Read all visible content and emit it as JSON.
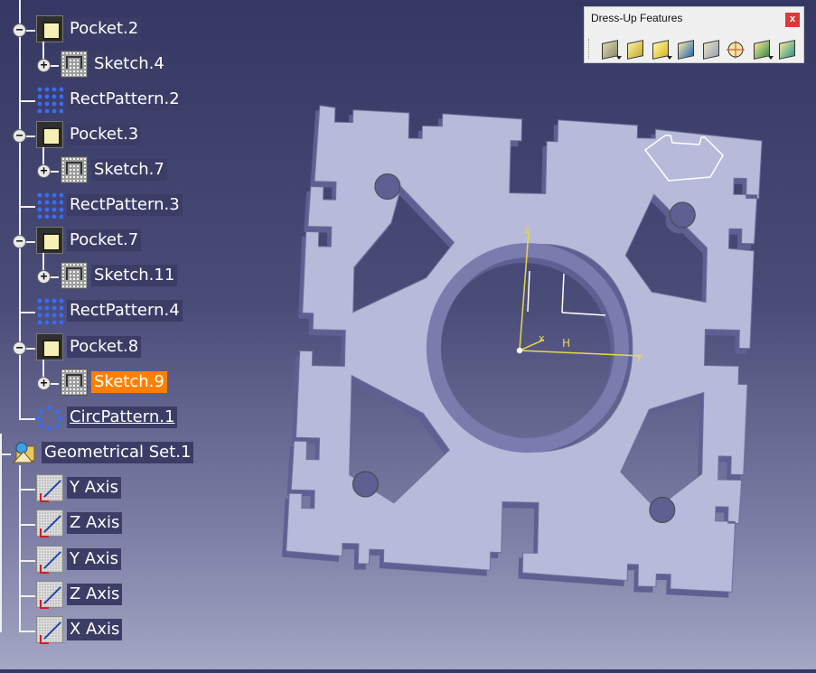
{
  "tree": {
    "items": [
      {
        "label": "Pocket.2",
        "icon": "pocket-icon"
      },
      {
        "label": "Sketch.4",
        "icon": "sketch-icon"
      },
      {
        "label": "RectPattern.2",
        "icon": "rect-pattern-icon"
      },
      {
        "label": "Pocket.3",
        "icon": "pocket-icon"
      },
      {
        "label": "Sketch.7",
        "icon": "sketch-icon"
      },
      {
        "label": "RectPattern.3",
        "icon": "rect-pattern-icon"
      },
      {
        "label": "Pocket.7",
        "icon": "pocket-icon"
      },
      {
        "label": "Sketch.11",
        "icon": "sketch-icon"
      },
      {
        "label": "RectPattern.4",
        "icon": "rect-pattern-icon"
      },
      {
        "label": "Pocket.8",
        "icon": "pocket-icon"
      },
      {
        "label": "Sketch.9",
        "icon": "sketch-icon",
        "selected": true
      },
      {
        "label": "CircPattern.1",
        "icon": "circ-pattern-icon",
        "underlined": true
      },
      {
        "label": "Geometrical Set.1",
        "icon": "geometrical-set-icon"
      },
      {
        "label": "Y Axis",
        "icon": "axis-icon"
      },
      {
        "label": "Z Axis",
        "icon": "axis-icon"
      },
      {
        "label": "Y Axis",
        "icon": "axis-icon"
      },
      {
        "label": "Z Axis",
        "icon": "axis-icon"
      },
      {
        "label": "X Axis",
        "icon": "axis-icon"
      }
    ]
  },
  "toolbar": {
    "title": "Dress-Up Features",
    "close_label": "x",
    "tools": [
      "edge-fillet-icon",
      "chamfer-icon",
      "draft-angle-icon",
      "shell-icon",
      "thickness-icon",
      "thread-tap-icon",
      "remove-face-icon",
      "replace-face-icon"
    ]
  },
  "viewport": {
    "axis_labels": {
      "z": "z",
      "x": "x",
      "y": "y",
      "h": "H"
    },
    "colors": {
      "part_face": "#b8bada",
      "part_side": "#5d6090",
      "selection": "#ffffff",
      "axis": "#e6d94a"
    }
  }
}
